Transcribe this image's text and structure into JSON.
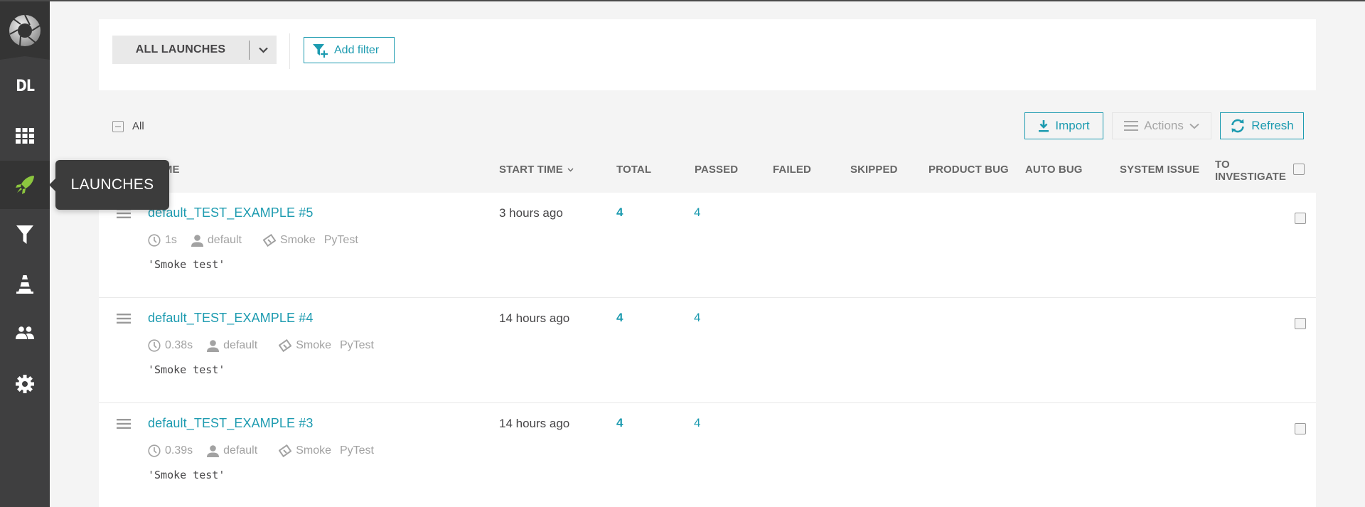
{
  "sidebar": {
    "project_initials": "DL",
    "items": [
      {
        "id": "dashboard",
        "icon": "grid-icon"
      },
      {
        "id": "launches",
        "icon": "rocket-icon",
        "active": true,
        "tooltip": "LAUNCHES"
      },
      {
        "id": "filters",
        "icon": "filter-icon"
      },
      {
        "id": "debug",
        "icon": "cone-icon"
      },
      {
        "id": "members",
        "icon": "users-icon"
      },
      {
        "id": "settings",
        "icon": "gear-icon"
      }
    ]
  },
  "filter_bar": {
    "launch_select": "ALL LAUNCHES",
    "add_filter": "Add filter"
  },
  "toolbar": {
    "select_all_label": "All",
    "import": "Import",
    "actions": "Actions",
    "refresh": "Refresh"
  },
  "table": {
    "columns": {
      "name": "NAME",
      "start_time": "START TIME",
      "total": "TOTAL",
      "passed": "PASSED",
      "failed": "FAILED",
      "skipped": "SKIPPED",
      "product_bug": "PRODUCT BUG",
      "auto_bug": "AUTO BUG",
      "system_issue": "SYSTEM ISSUE",
      "to_investigate_1": "TO",
      "to_investigate_2": "INVESTIGATE"
    },
    "rows": [
      {
        "name": "default_TEST_EXAMPLE #5",
        "duration": "1s",
        "owner": "default",
        "tags": [
          "Smoke",
          "PyTest"
        ],
        "description": "'Smoke test'",
        "start_time": "3 hours ago",
        "total": "4",
        "passed": "4"
      },
      {
        "name": "default_TEST_EXAMPLE #4",
        "duration": "0.38s",
        "owner": "default",
        "tags": [
          "Smoke",
          "PyTest"
        ],
        "description": "'Smoke test'",
        "start_time": "14 hours ago",
        "total": "4",
        "passed": "4"
      },
      {
        "name": "default_TEST_EXAMPLE #3",
        "duration": "0.39s",
        "owner": "default",
        "tags": [
          "Smoke",
          "PyTest"
        ],
        "description": "'Smoke test'",
        "start_time": "14 hours ago",
        "total": "4",
        "passed": "4"
      }
    ]
  },
  "colors": {
    "accent": "#1d9bb0",
    "sidebar_bg": "#3f3f40",
    "launches_icon": "#8cc63f"
  }
}
